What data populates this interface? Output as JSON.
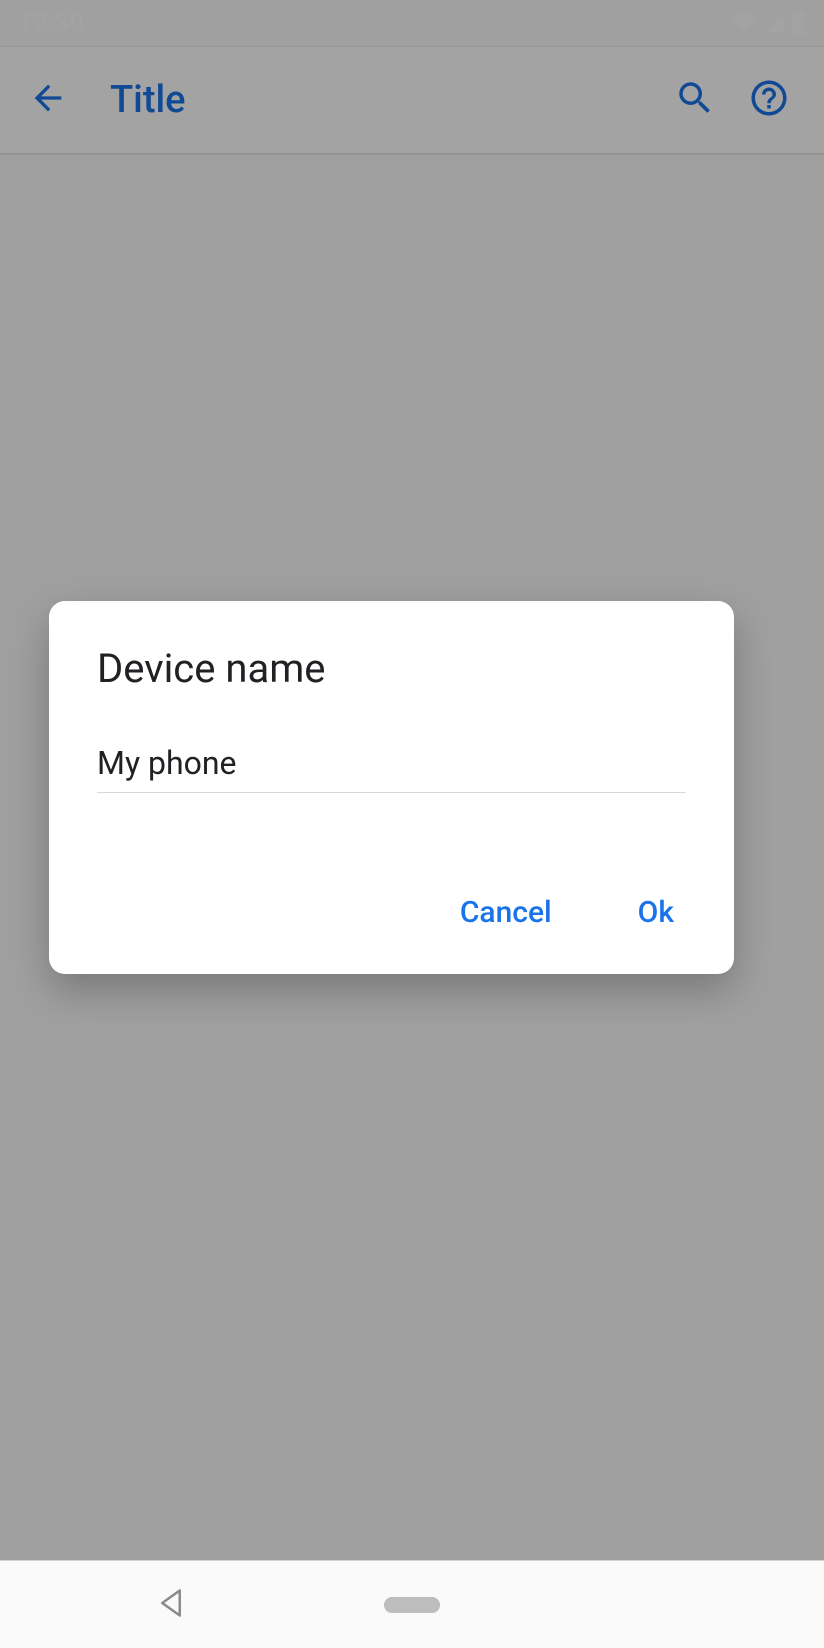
{
  "status": {
    "time": "12:30"
  },
  "appbar": {
    "title": "Title"
  },
  "dialog": {
    "title": "Device name",
    "input_value": "My phone",
    "cancel_label": "Cancel",
    "ok_label": "Ok"
  },
  "colors": {
    "accent": "#1a73e8"
  }
}
